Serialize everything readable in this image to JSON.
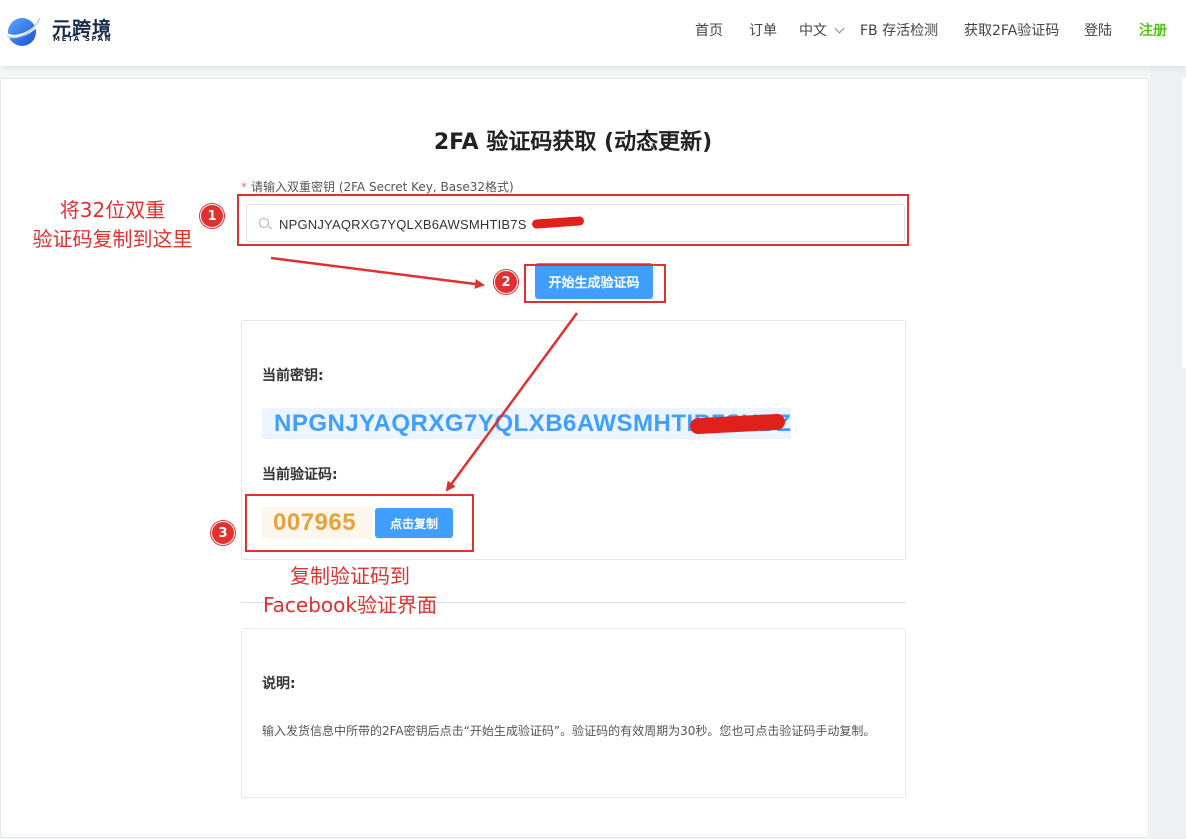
{
  "header": {
    "logo_cn": "元跨境",
    "logo_en": "META SPAN",
    "nav": {
      "home": "首页",
      "orders": "订单",
      "language": "中文",
      "fb_check": "FB 存活检测",
      "get_2fa": "获取2FA验证码",
      "login": "登陆",
      "register": "注册"
    },
    "accent_color": "#52c41a"
  },
  "main": {
    "title": "2FA 验证码获取 (动态更新)",
    "required_mark": "*",
    "secret_label": "请输入双重密钥 (2FA Secret Key, Base32格式)",
    "secret_value": "NPGNJYAQRXG7YQLXB6AWSMHTIB7S",
    "generate_button": "开始生成验证码",
    "current_key_label": "当前密钥:",
    "current_key_value": "NPGNJYAQRXG7YQLXB6AWSMHTIB7SYBZ3L",
    "current_code_label": "当前验证码:",
    "current_code_value": "007965",
    "copy_button": "点击复制",
    "note_title": "说明:",
    "note_text": "输入发货信息中所带的2FA密钥后点击“开始生成验证码”。验证码的有效周期为30秒。您也可点击验证码手动复制。",
    "primary_color": "#409eff",
    "code_color": "#e6a23c"
  },
  "annotations": {
    "step1_badge": "1",
    "step1_text_line1": "将32位双重",
    "step1_text_line2": "验证码复制到这里",
    "step2_badge": "2",
    "step3_badge": "3",
    "step3_text_line1": "复制验证码到",
    "step3_text_line2": "Facebook验证界面",
    "color": "#e03131"
  }
}
